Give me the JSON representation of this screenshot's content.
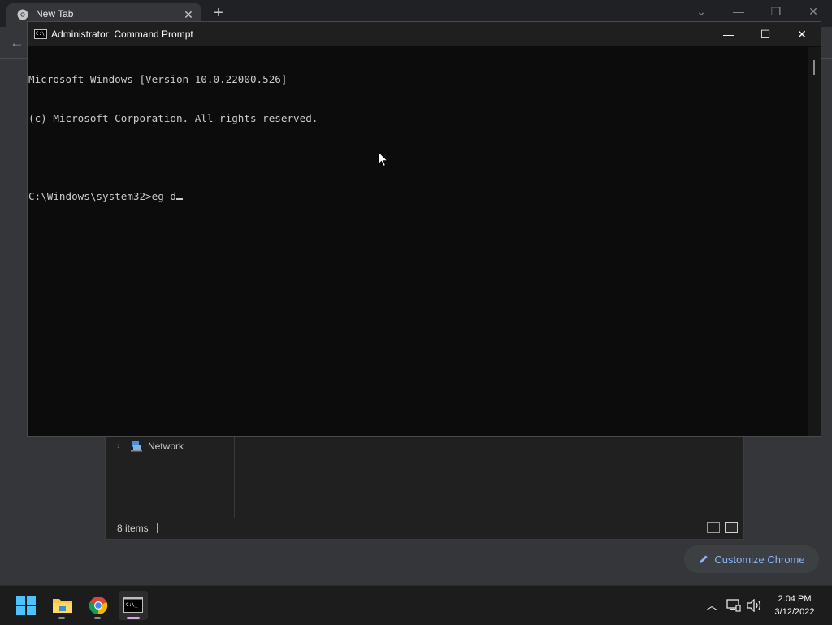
{
  "chrome": {
    "tab_title": "New Tab",
    "tab_close_glyph": "✕",
    "new_tab_glyph": "+",
    "back_glyph": "←",
    "window_controls": [
      "⌄",
      "—",
      "❐",
      "✕"
    ],
    "customize_label": "Customize Chrome",
    "customize_icon": "pencil-icon"
  },
  "explorer": {
    "nav_item": "Network",
    "status_items": "8 items"
  },
  "cmd": {
    "title": "Administrator: Command Prompt",
    "controls": {
      "minimize": "—",
      "maximize": "☐",
      "close": "✕"
    },
    "lines": [
      "Microsoft Windows [Version 10.0.22000.526]",
      "(c) Microsoft Corporation. All rights reserved.",
      "",
      "C:\\Windows\\system32>eg d"
    ]
  },
  "taskbar": {
    "apps": [
      "start-icon",
      "file-explorer-icon",
      "chrome-icon",
      "command-prompt-icon"
    ],
    "tray_glyphs": {
      "chevron": "︿",
      "network": "▭",
      "volume": "🔊"
    },
    "time": "2:04 PM",
    "date": "3/12/2022"
  },
  "colors": {
    "cmd_background": "#0c0c0c",
    "cmd_text": "#cccccc",
    "accent_link": "#8ab4f8",
    "taskbar": "#1c1c1c"
  }
}
